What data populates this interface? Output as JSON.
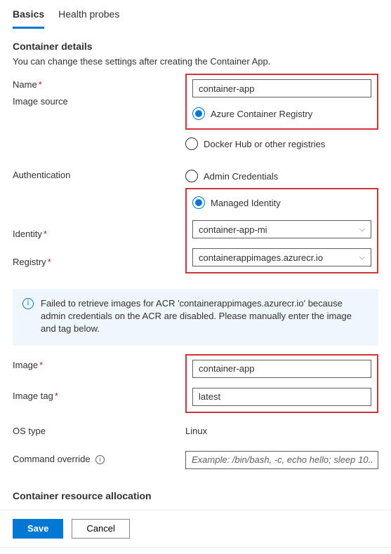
{
  "tabs": {
    "basics": "Basics",
    "health": "Health probes"
  },
  "section1": {
    "title": "Container details",
    "desc": "You can change these settings after creating the Container App."
  },
  "labels": {
    "name": "Name",
    "imageSource": "Image source",
    "authentication": "Authentication",
    "identity": "Identity",
    "registry": "Registry",
    "image": "Image",
    "imageTag": "Image tag",
    "osType": "OS type",
    "commandOverride": "Command override"
  },
  "values": {
    "name": "container-app",
    "identity": "container-app-mi",
    "registry": "containerappimages.azurecr.io",
    "image": "container-app",
    "imageTag": "latest",
    "osType": "Linux",
    "commandPlaceholder": "Example: /bin/bash, -c, echo hello; sleep 10..."
  },
  "radios": {
    "acr": "Azure Container Registry",
    "docker": "Docker Hub or other registries",
    "admin": "Admin Credentials",
    "managed": "Managed Identity"
  },
  "info": "Failed to retrieve images for ACR 'containerappimages.azurecr.io' because admin credentials on the ACR are disabled. Please manually enter the image and tag below.",
  "section2": {
    "title": "Container resource allocation"
  },
  "footer": {
    "save": "Save",
    "cancel": "Cancel"
  }
}
